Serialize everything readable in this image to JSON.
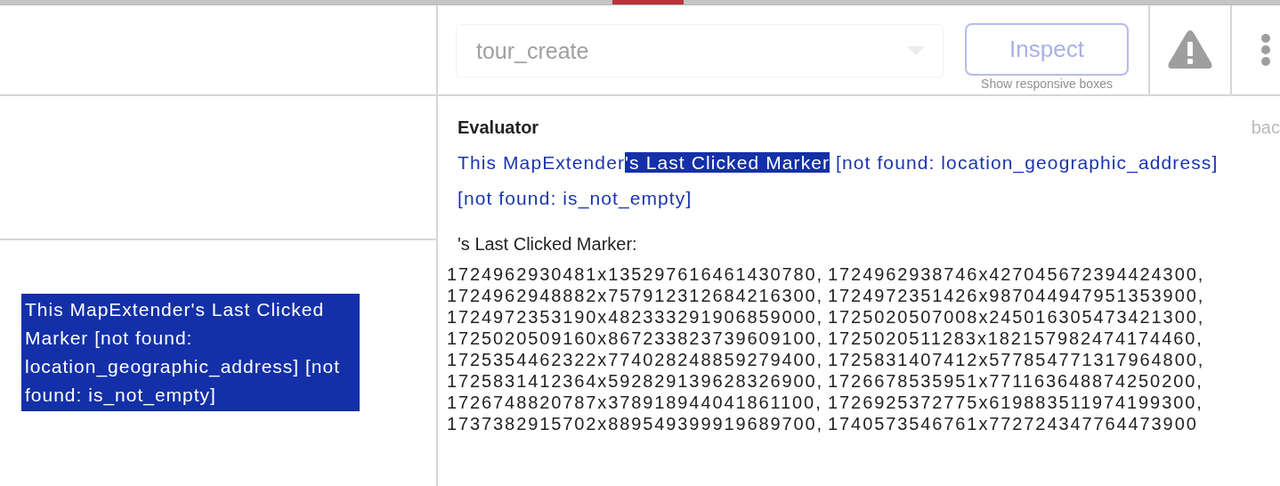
{
  "top_strip": {
    "active_tab_indicator": true
  },
  "toolbar": {
    "dropdown": {
      "value": "tour_create",
      "disabled": true
    },
    "inspect_button": {
      "label": "Inspect",
      "disabled": true
    },
    "inspect_hint": "Show responsive boxes"
  },
  "element_preview": {
    "text": "This MapExtender's Last Clicked Marker [not found: location_geographic_address] [not found: is_not_empty]",
    "selected": true
  },
  "evaluator": {
    "title": "Evaluator",
    "back_link": "bac",
    "expression": [
      {
        "text": "This MapExtender",
        "selected": false
      },
      {
        "text": "'s Last Clicked Marker",
        "selected": true
      },
      {
        "text": " [not found: location_geographic_address]",
        "selected": false
      },
      {
        "text": " [not found: is_not_empty]",
        "selected": false
      }
    ],
    "result_label": "'s Last Clicked Marker:",
    "result_values": [
      "1724962930481x135297616461430780,",
      "1724962938746x427045672394424300,",
      "1724962948882x757912312684216300,",
      "1724972351426x987044947951353900,",
      "1724972353190x482333291906859000,",
      "1725020507008x245016305473421300,",
      "1725020509160x867233823739609100,",
      "1725020511283x182157982474174460,",
      "1725354462322x774028248859279400,",
      "1725831407412x577854771317964800,",
      "1725831412364x592829139628326900,",
      "1726678535951x771163648874250200,",
      "1726748820787x378918944041861100,",
      "1726925372775x619883511974199300,",
      "1737382915702x889549399919689700,",
      "1740573546761x772724347764473900"
    ]
  }
}
